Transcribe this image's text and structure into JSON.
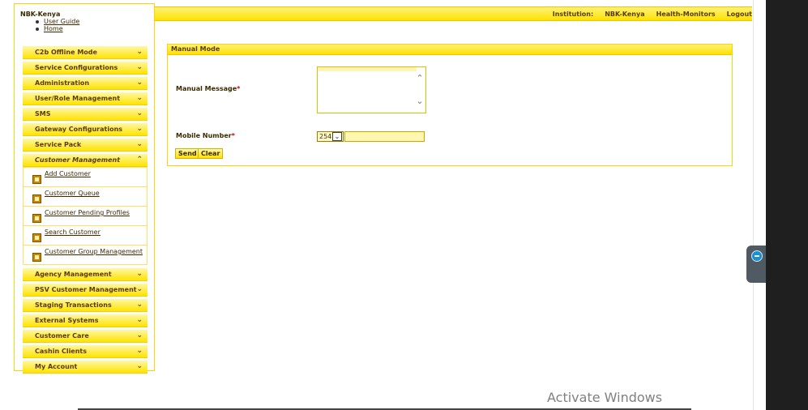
{
  "header": {
    "brand": "NBK-Kenya",
    "links": [
      "User Guide",
      "Home"
    ],
    "institution_label": "Institution:",
    "institution_value": "NBK-Kenya",
    "health_link": "Health-Monitors",
    "logout": "Logout"
  },
  "sidebar": {
    "items": [
      {
        "label": "C2b Offline Mode"
      },
      {
        "label": "Service Configurations"
      },
      {
        "label": "Administration"
      },
      {
        "label": "User/Role Management"
      },
      {
        "label": "SMS"
      },
      {
        "label": "Gateway Configurations"
      },
      {
        "label": "Service Pack"
      },
      {
        "label": "Customer Management"
      },
      {
        "label": "Agency Management"
      },
      {
        "label": "PSV Customer Management"
      },
      {
        "label": "Staging Transactions"
      },
      {
        "label": "External Systems"
      },
      {
        "label": "Customer Care"
      },
      {
        "label": "Cashin Clients"
      },
      {
        "label": "My Account"
      }
    ],
    "customer_management_subitems": [
      {
        "label": "Add Customer"
      },
      {
        "label": "Customer Queue"
      },
      {
        "label": "Customer Pending Profiles"
      },
      {
        "label": "Search Customer"
      },
      {
        "label": "Customer Group Management"
      }
    ]
  },
  "panel": {
    "title": "Manual Mode",
    "manual_message_label": "Manual Message",
    "mobile_number_label": "Mobile Number",
    "required_mark": "*",
    "country_code": "254",
    "send_label": "Send",
    "clear_label": "Clear"
  },
  "overlay": {
    "activate_windows": "Activate Windows"
  }
}
